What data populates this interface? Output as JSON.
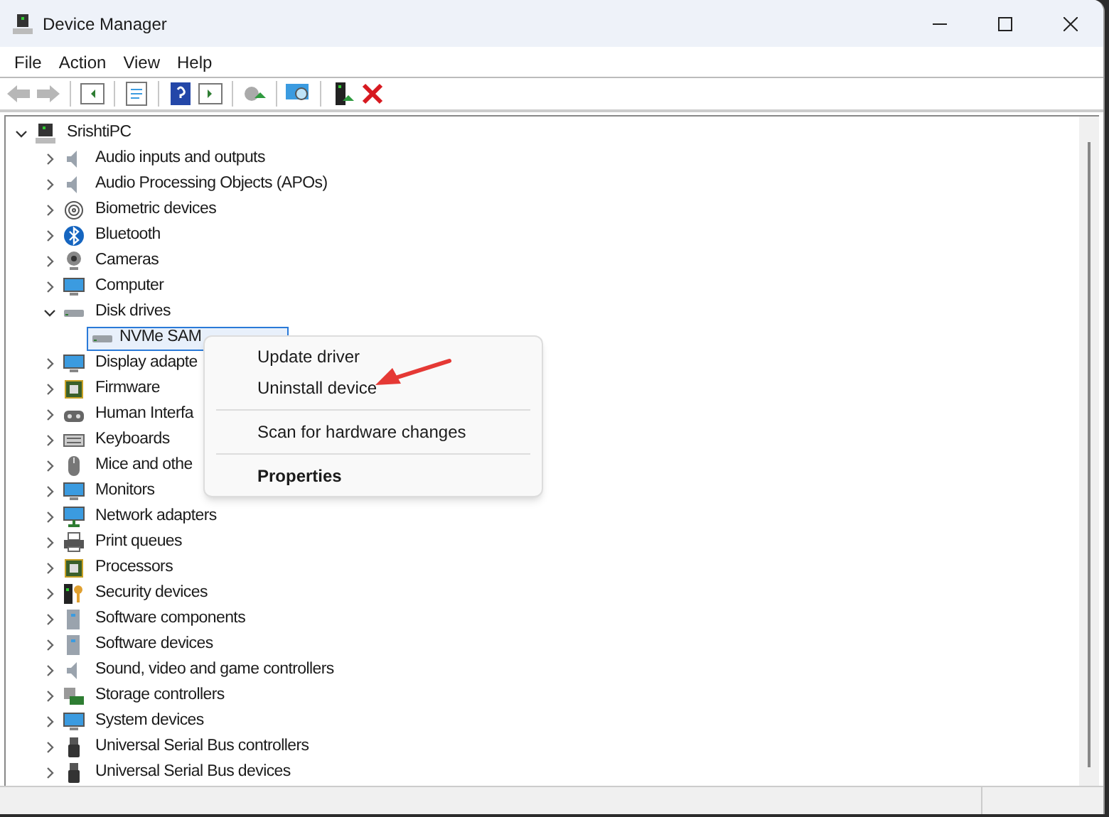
{
  "window": {
    "title": "Device Manager"
  },
  "menu_bar": [
    "File",
    "Action",
    "View",
    "Help"
  ],
  "tree": {
    "label": "SrishtiPC",
    "expanded": true,
    "children": [
      {
        "label": "Audio inputs and outputs",
        "expanded": false
      },
      {
        "label": "Audio Processing Objects (APOs)",
        "expanded": false
      },
      {
        "label": "Biometric devices",
        "expanded": false
      },
      {
        "label": "Bluetooth",
        "expanded": false
      },
      {
        "label": "Cameras",
        "expanded": false
      },
      {
        "label": "Computer",
        "expanded": false
      },
      {
        "label": "Disk drives",
        "expanded": true,
        "children": [
          {
            "label": "NVMe SAM",
            "selected": true
          }
        ]
      },
      {
        "label": "Display adapte",
        "expanded": false
      },
      {
        "label": "Firmware",
        "expanded": false
      },
      {
        "label": "Human Interfa",
        "expanded": false
      },
      {
        "label": "Keyboards",
        "expanded": false
      },
      {
        "label": "Mice and othe",
        "expanded": false
      },
      {
        "label": "Monitors",
        "expanded": false
      },
      {
        "label": "Network adapters",
        "expanded": false
      },
      {
        "label": "Print queues",
        "expanded": false
      },
      {
        "label": "Processors",
        "expanded": false
      },
      {
        "label": "Security devices",
        "expanded": false
      },
      {
        "label": "Software components",
        "expanded": false
      },
      {
        "label": "Software devices",
        "expanded": false
      },
      {
        "label": "Sound, video and game controllers",
        "expanded": false
      },
      {
        "label": "Storage controllers",
        "expanded": false
      },
      {
        "label": "System devices",
        "expanded": false
      },
      {
        "label": "Universal Serial Bus controllers",
        "expanded": false
      },
      {
        "label": "Universal Serial Bus devices",
        "expanded": false
      }
    ]
  },
  "context_menu": [
    {
      "kind": "item",
      "label": "Update driver",
      "default": false
    },
    {
      "kind": "item",
      "label": "Uninstall device",
      "default": false
    },
    {
      "kind": "separator"
    },
    {
      "kind": "item",
      "label": "Scan for hardware changes",
      "default": false
    },
    {
      "kind": "separator"
    },
    {
      "kind": "item",
      "label": "Properties",
      "default": true
    }
  ]
}
